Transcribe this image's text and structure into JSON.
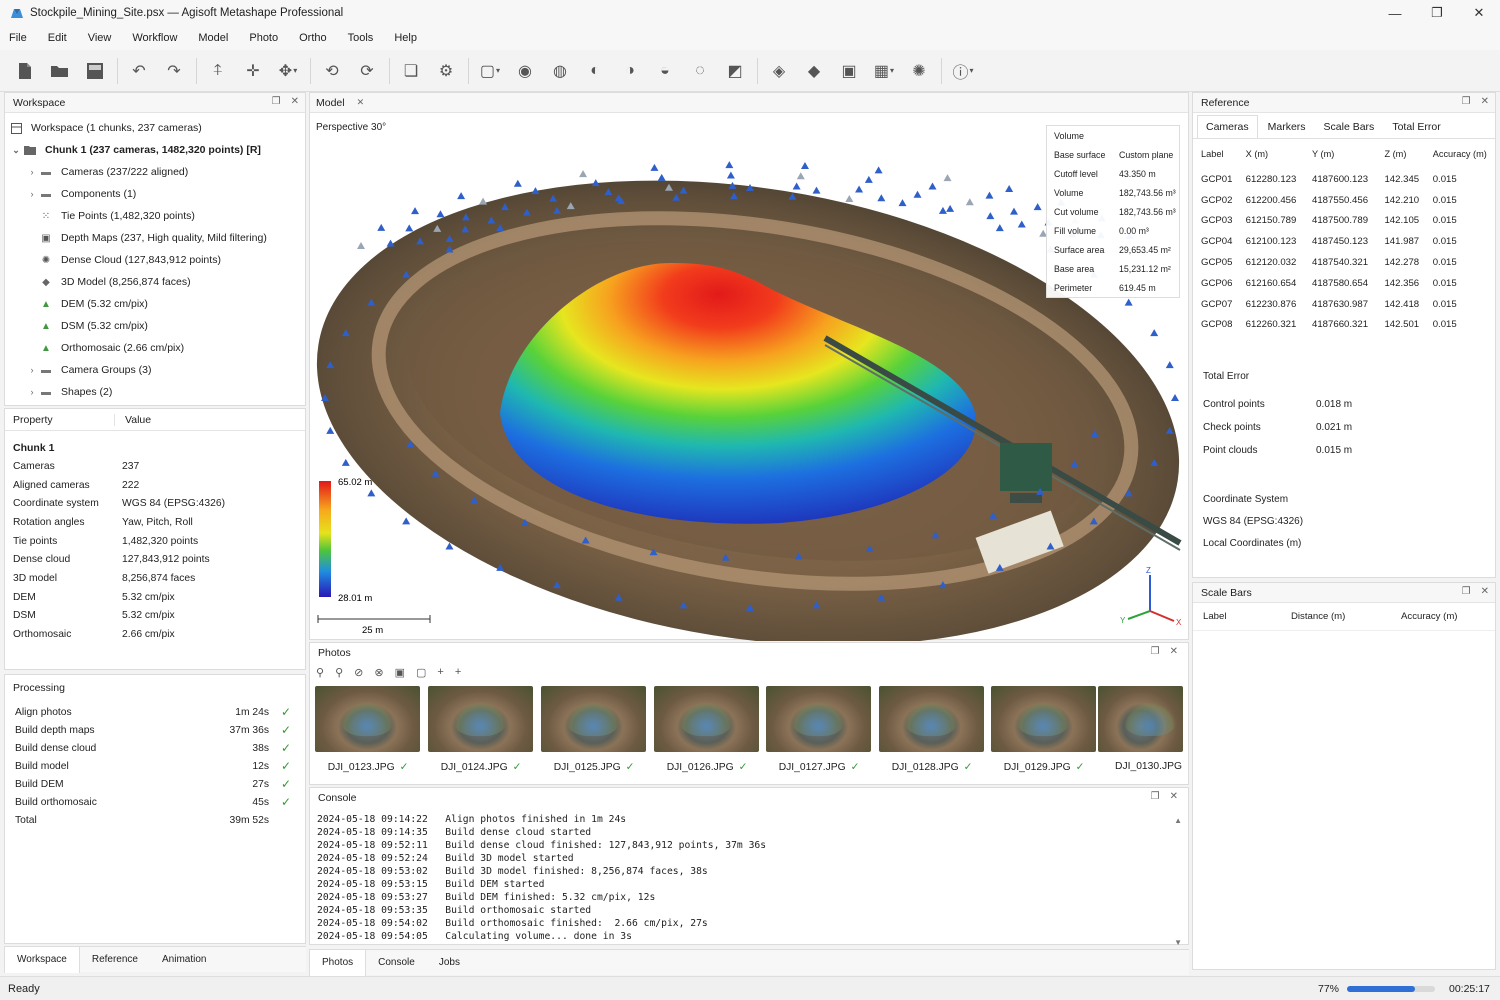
{
  "window": {
    "title": "Stockpile_Mining_Site.psx — Agisoft Metashape Professional",
    "controls": [
      "—",
      "❐",
      "✕"
    ]
  },
  "menu": [
    "File",
    "Edit",
    "View",
    "Workflow",
    "Model",
    "Photo",
    "Ortho",
    "Tools",
    "Help"
  ],
  "workspace": {
    "title": "Workspace",
    "root": "Workspace (1 chunks, 237 cameras)",
    "chunk": "Chunk 1 (237 cameras, 1482,320 points) [R]",
    "items": [
      {
        "label": "Cameras (237/222 aligned)",
        "icon": "folder-icon",
        "expandable": true
      },
      {
        "label": "Components (1)",
        "icon": "folder-icon",
        "expandable": true
      },
      {
        "label": "Tie Points (1,482,320 points)",
        "icon": "tie-points-icon",
        "expandable": false
      },
      {
        "label": "Depth Maps (237, High quality, Mild filtering)",
        "icon": "depth-maps-icon",
        "expandable": false
      },
      {
        "label": "Dense Cloud (127,843,912 points)",
        "icon": "dense-cloud-icon",
        "expandable": false
      },
      {
        "label": "3D Model (8,256,874 faces)",
        "icon": "model-icon",
        "expandable": false
      },
      {
        "label": "DEM (5.32 cm/pix)",
        "icon": "dem-icon",
        "expandable": false
      },
      {
        "label": "DSM (5.32 cm/pix)",
        "icon": "dsm-icon",
        "expandable": false
      },
      {
        "label": "Orthomosaic (2.66 cm/pix)",
        "icon": "orthomosaic-icon",
        "expandable": false
      },
      {
        "label": "Camera Groups (3)",
        "icon": "folder-icon",
        "expandable": true
      },
      {
        "label": "Shapes (2)",
        "icon": "folder-icon",
        "expandable": true
      }
    ]
  },
  "properties": {
    "header_property": "Property",
    "header_value": "Value",
    "section": "Chunk 1",
    "rows": [
      {
        "k": "Cameras",
        "v": "237"
      },
      {
        "k": "Aligned cameras",
        "v": "222"
      },
      {
        "k": "Coordinate system",
        "v": "WGS 84 (EPSG:4326)"
      },
      {
        "k": "Rotation angles",
        "v": "Yaw, Pitch, Roll"
      },
      {
        "k": "Tie points",
        "v": "1,482,320 points"
      },
      {
        "k": "Dense cloud",
        "v": "127,843,912 points"
      },
      {
        "k": "3D model",
        "v": "8,256,874 faces"
      },
      {
        "k": "DEM",
        "v": "5.32 cm/pix"
      },
      {
        "k": "DSM",
        "v": "5.32 cm/pix"
      },
      {
        "k": "Orthomosaic",
        "v": "2.66 cm/pix"
      }
    ]
  },
  "processing": {
    "title": "Processing",
    "rows": [
      {
        "name": "Align photos",
        "time": "1m 24s",
        "done": "✓"
      },
      {
        "name": "Build depth maps",
        "time": "37m 36s",
        "done": "✓"
      },
      {
        "name": "Build dense cloud",
        "time": "38s",
        "done": "✓"
      },
      {
        "name": "Build model",
        "time": "12s",
        "done": "✓"
      },
      {
        "name": "Build DEM",
        "time": "27s",
        "done": "✓"
      },
      {
        "name": "Build orthomosaic",
        "time": "45s",
        "done": "✓"
      },
      {
        "name": "Total",
        "time": "39m 52s",
        "done": ""
      }
    ]
  },
  "left_tabs": [
    "Workspace",
    "Reference",
    "Animation"
  ],
  "model": {
    "tab": "Model",
    "view_label": "Perspective 30°",
    "legend_max": "65.02 m",
    "legend_min": "28.01 m",
    "scale_label": "25 m",
    "axes": {
      "x": "X",
      "y": "Y",
      "z": "Z"
    },
    "volume": {
      "title": "Volume",
      "rows": [
        {
          "k": "Base surface",
          "v": "Custom plane"
        },
        {
          "k": "Cutoff level",
          "v": "43.350 m"
        },
        {
          "k": "Volume",
          "v": "182,743.56 m³"
        },
        {
          "k": "Cut volume",
          "v": "182,743.56 m³"
        },
        {
          "k": "Fill volume",
          "v": "0.00 m³"
        },
        {
          "k": "Surface area",
          "v": "29,653.45 m²"
        },
        {
          "k": "Base area",
          "v": "15,231.12 m²"
        },
        {
          "k": "Perimeter",
          "v": "619.45 m"
        }
      ]
    }
  },
  "photos": {
    "title": "Photos",
    "items": [
      {
        "name": "DJI_0123.JPG",
        "check": "✓"
      },
      {
        "name": "DJI_0124.JPG",
        "check": "✓"
      },
      {
        "name": "DJI_0125.JPG",
        "check": "✓"
      },
      {
        "name": "DJI_0126.JPG",
        "check": "✓"
      },
      {
        "name": "DJI_0127.JPG",
        "check": "✓"
      },
      {
        "name": "DJI_0128.JPG",
        "check": "✓"
      },
      {
        "name": "DJI_0129.JPG",
        "check": "✓"
      },
      {
        "name": "DJI_0130.JPG",
        "check": ""
      }
    ]
  },
  "console": {
    "title": "Console",
    "lines": [
      "2024-05-18 09:14:22   Align photos finished in 1m 24s",
      "2024-05-18 09:14:35   Build dense cloud started",
      "2024-05-18 09:52:11   Build dense cloud finished: 127,843,912 points, 37m 36s",
      "2024-05-18 09:52:24   Build 3D model started",
      "2024-05-18 09:53:02   Build 3D model finished: 8,256,874 faces, 38s",
      "2024-05-18 09:53:15   Build DEM started",
      "2024-05-18 09:53:27   Build DEM finished: 5.32 cm/pix, 12s",
      "2024-05-18 09:53:35   Build orthomosaic started",
      "2024-05-18 09:54:02   Build orthomosaic finished:  2.66 cm/pix, 27s",
      "2024-05-18 09:54:05   Calculating volume... done in 3s"
    ]
  },
  "center_tabs": [
    "Photos",
    "Console",
    "Jobs"
  ],
  "reference": {
    "title": "Reference",
    "tabs": [
      "Cameras",
      "Markers",
      "Scale Bars",
      "Total Error"
    ],
    "headers": [
      "Label",
      "X (m)",
      "Y (m)",
      "Z (m)",
      "Accuracy (m)"
    ],
    "rows": [
      [
        "GCP01",
        "612280.123",
        "4187600.123",
        "142.345",
        "0.015"
      ],
      [
        "GCP02",
        "612200.456",
        "4187550.456",
        "142.210",
        "0.015"
      ],
      [
        "GCP03",
        "612150.789",
        "4187500.789",
        "142.105",
        "0.015"
      ],
      [
        "GCP04",
        "612100.123",
        "4187450.123",
        "141.987",
        "0.015"
      ],
      [
        "GCP05",
        "612120.032",
        "4187540.321",
        "142.278",
        "0.015"
      ],
      [
        "GCP06",
        "612160.654",
        "4187580.654",
        "142.356",
        "0.015"
      ],
      [
        "GCP07",
        "612230.876",
        "4187630.987",
        "142.418",
        "0.015"
      ],
      [
        "GCP08",
        "612260.321",
        "4187660.321",
        "142.501",
        "0.015"
      ]
    ],
    "total_error_title": "Total Error",
    "total_error": [
      {
        "k": "Control points",
        "v": "0.018 m"
      },
      {
        "k": "Check points",
        "v": "0.021 m"
      },
      {
        "k": "Point clouds",
        "v": "0.015 m"
      }
    ],
    "coord_title": "Coordinate System",
    "coord_system": "WGS 84 (EPSG:4326)",
    "coord_local": "Local Coordinates (m)"
  },
  "scale_bars": {
    "title": "Scale Bars",
    "headers": [
      "Label",
      "Distance (m)",
      "Accuracy (m)"
    ]
  },
  "status": {
    "text": "Ready",
    "progress_label": "77%",
    "progress": 0.77,
    "time": "00:25:17"
  },
  "colors": {
    "accent": "#2f6fd6",
    "check": "#2e9b33"
  }
}
